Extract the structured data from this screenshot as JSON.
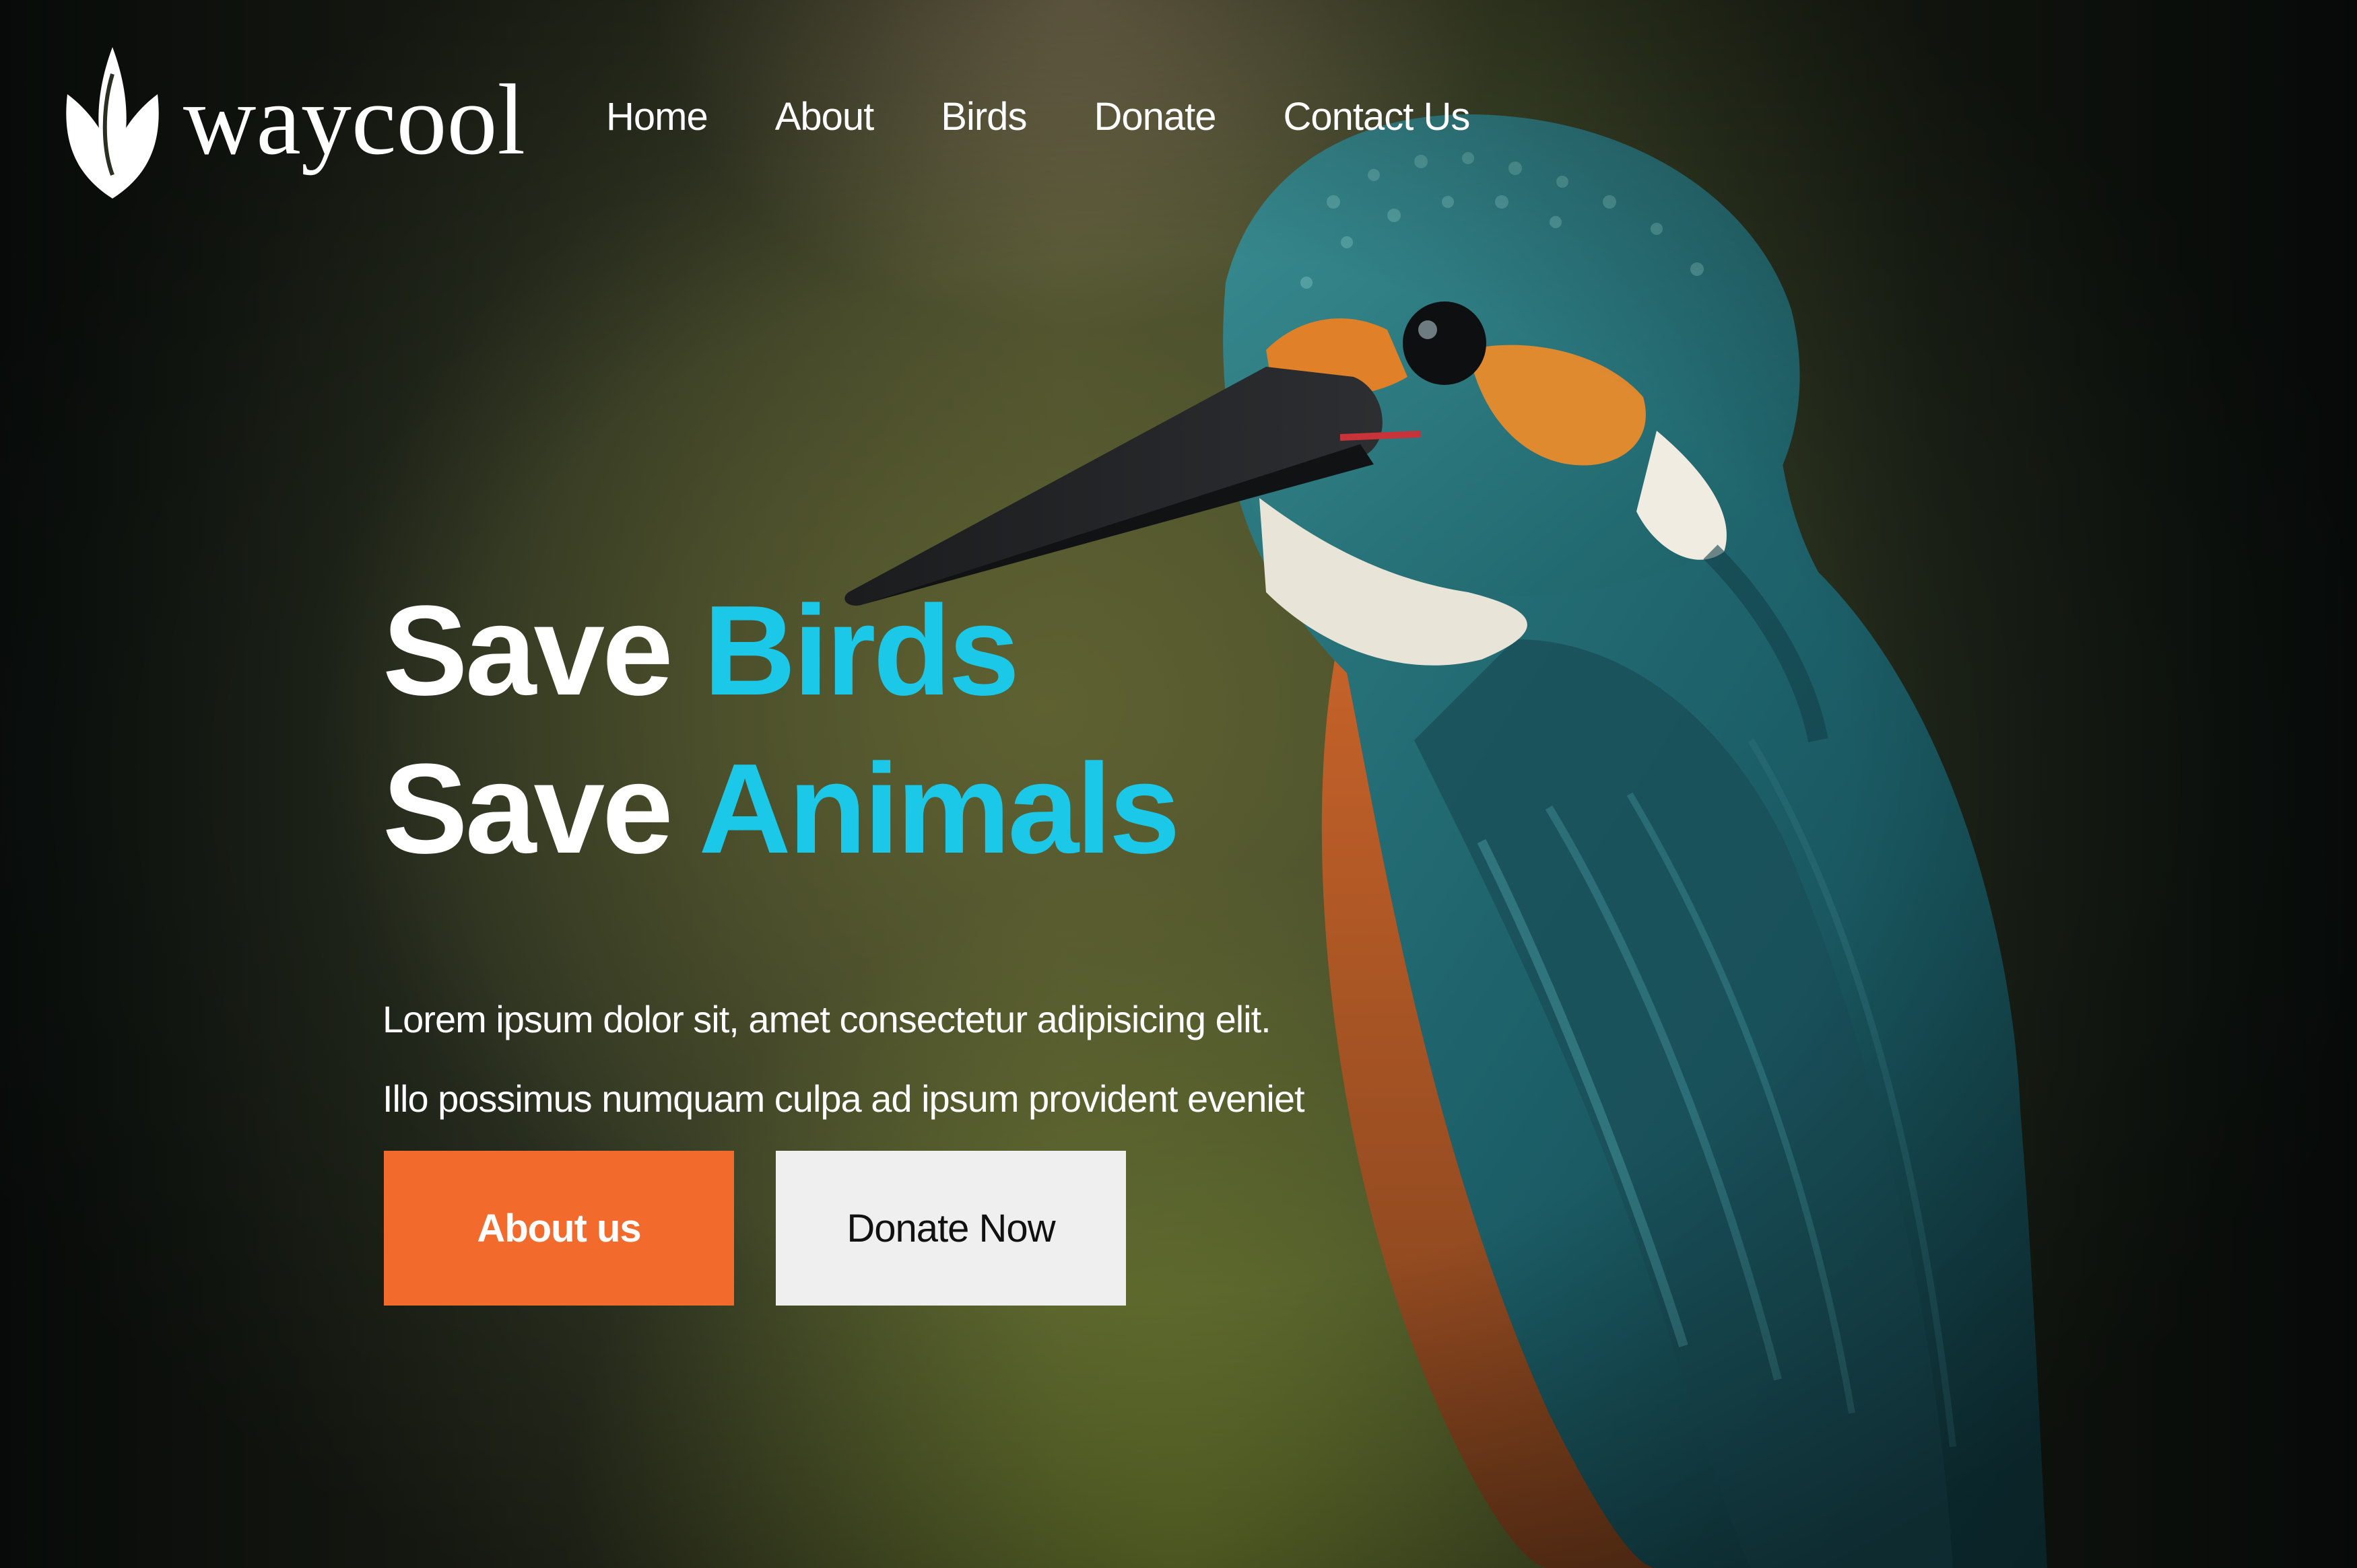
{
  "brand": {
    "name": "waycool",
    "icon": "leaf-icon"
  },
  "nav": {
    "items": [
      {
        "label": "Home"
      },
      {
        "label": "About"
      },
      {
        "label": "Birds"
      },
      {
        "label": "Donate"
      },
      {
        "label": "Contact Us"
      }
    ]
  },
  "hero": {
    "line1": {
      "word": "Save",
      "accent": "Birds"
    },
    "line2": {
      "word": "Save",
      "accent": "Animals"
    },
    "description": "Lorem ipsum dolor sit, amet consectetur adipisicing elit. Illo possimus numquam culpa ad ipsum provident eveniet",
    "buttons": {
      "primary": "About us",
      "secondary": "Donate Now"
    },
    "image": "kingfisher-bird"
  },
  "colors": {
    "accent": "#1cc8e8",
    "primary_button": "#f36a2d",
    "secondary_button": "#efefef"
  }
}
